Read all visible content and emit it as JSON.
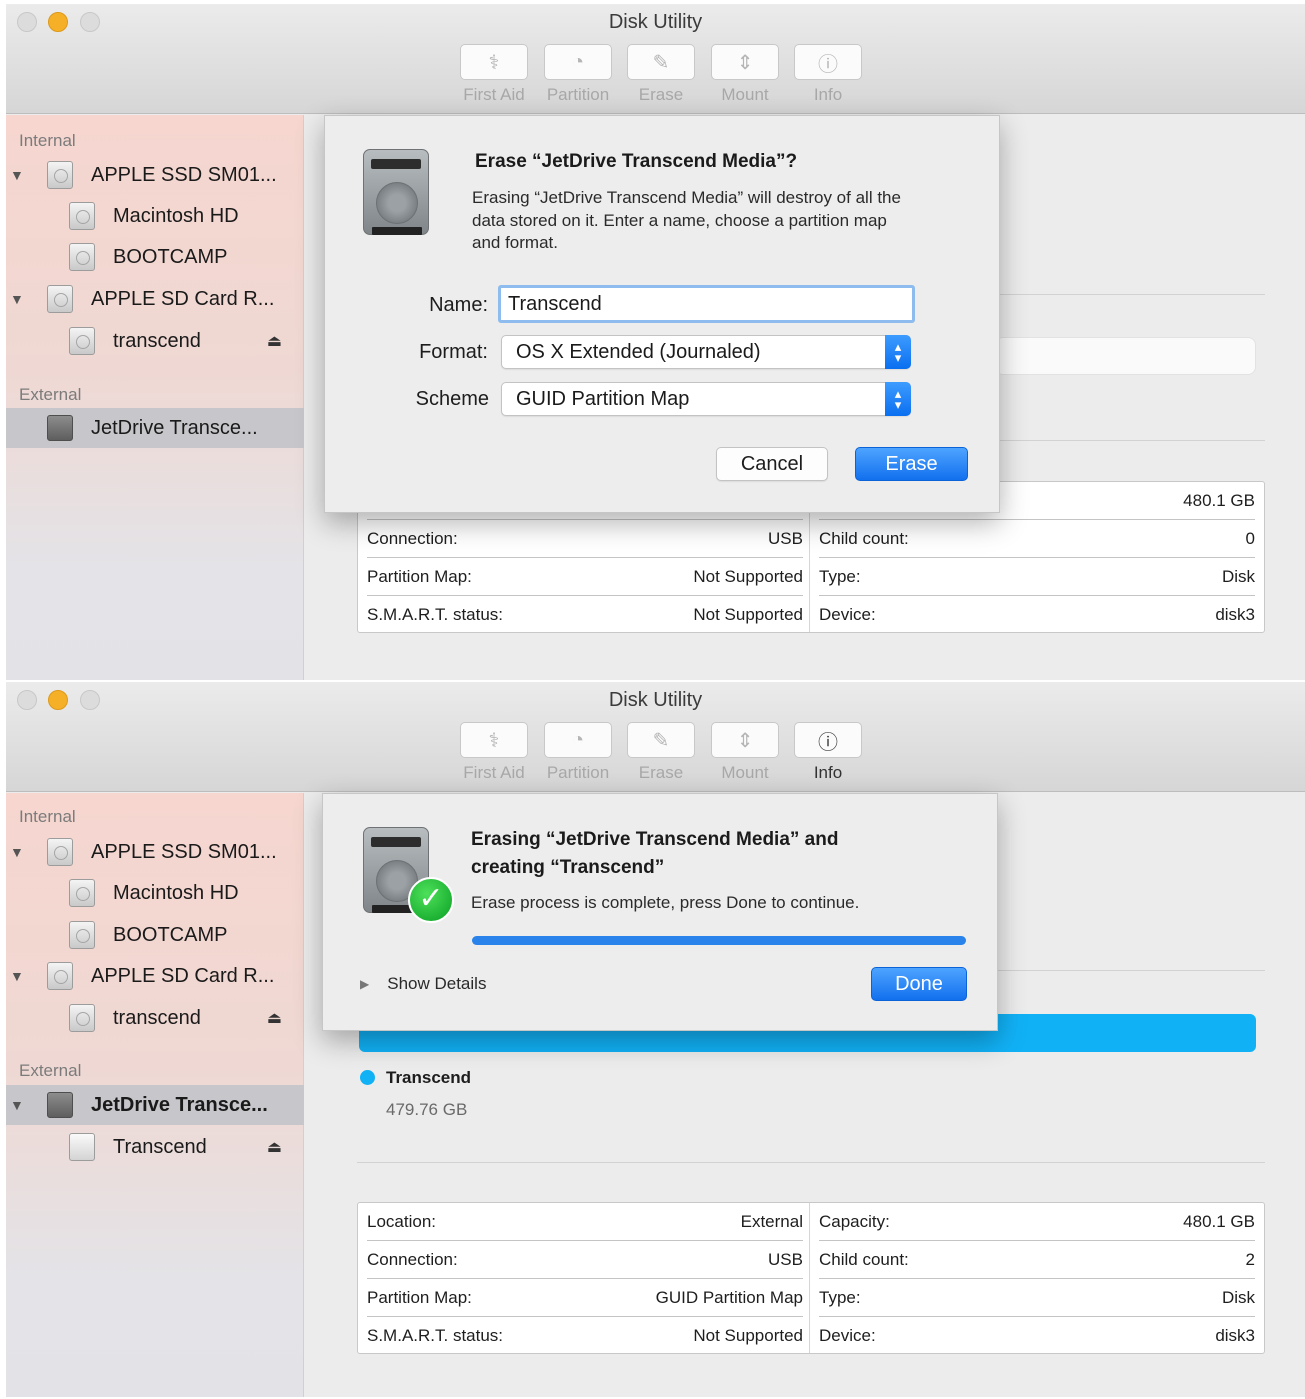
{
  "window1": {
    "title": "Disk Utility",
    "toolbar": [
      "First Aid",
      "Partition",
      "Erase",
      "Mount",
      "Info"
    ],
    "sidebar": {
      "internal_label": "Internal",
      "items": [
        "APPLE SSD SM01...",
        "Macintosh HD",
        "BOOTCAMP",
        "APPLE SD Card R...",
        "transcend"
      ],
      "external_label": "External",
      "external_items": [
        "JetDrive Transce..."
      ]
    },
    "dialog": {
      "title": "Erase “JetDrive Transcend Media”?",
      "message_lines": [
        "Erasing “JetDrive Transcend Media” will destroy of all the",
        "data stored on it. Enter a name, choose a partition map",
        "and format."
      ],
      "name_label": "Name:",
      "name_value": "Transcend",
      "format_label": "Format:",
      "format_value": "OS X Extended (Journaled)",
      "scheme_label": "Scheme",
      "scheme_value": "GUID Partition Map",
      "cancel": "Cancel",
      "erase": "Erase"
    },
    "capacity_value": "480.1 GB",
    "info": {
      "left": [
        {
          "label": "Connection:",
          "value": "USB"
        },
        {
          "label": "Partition Map:",
          "value": "Not Supported"
        },
        {
          "label": "S.M.A.R.T. status:",
          "value": "Not Supported"
        }
      ],
      "right": [
        {
          "label": "Child count:",
          "value": "0"
        },
        {
          "label": "Type:",
          "value": "Disk"
        },
        {
          "label": "Device:",
          "value": "disk3"
        }
      ]
    }
  },
  "window2": {
    "title": "Disk Utility",
    "toolbar": [
      "First Aid",
      "Partition",
      "Erase",
      "Mount",
      "Info"
    ],
    "sidebar": {
      "internal_label": "Internal",
      "items": [
        "APPLE SSD SM01...",
        "Macintosh HD",
        "BOOTCAMP",
        "APPLE SD Card R...",
        "transcend"
      ],
      "external_label": "External",
      "external_items": [
        "JetDrive Transce...",
        "Transcend"
      ]
    },
    "dialog": {
      "title_lines": [
        "Erasing “JetDrive Transcend Media” and",
        "creating “Transcend”"
      ],
      "message": "Erase process is complete, press Done to continue.",
      "progress": 1.0,
      "show_details": "Show Details",
      "done": "Done"
    },
    "partition": {
      "name": "Transcend",
      "size": "479.76 GB",
      "color": "#11b1f6"
    },
    "info": {
      "left": [
        {
          "label": "Location:",
          "value": "External"
        },
        {
          "label": "Connection:",
          "value": "USB"
        },
        {
          "label": "Partition Map:",
          "value": "GUID Partition Map"
        },
        {
          "label": "S.M.A.R.T. status:",
          "value": "Not Supported"
        }
      ],
      "right": [
        {
          "label": "Capacity:",
          "value": "480.1 GB"
        },
        {
          "label": "Child count:",
          "value": "2"
        },
        {
          "label": "Type:",
          "value": "Disk"
        },
        {
          "label": "Device:",
          "value": "disk3"
        }
      ]
    }
  },
  "icons": {
    "first_aid": "stethoscope-icon",
    "partition": "pie-icon",
    "erase": "eraser-icon",
    "mount": "mount-arrows-icon",
    "info": "info-icon",
    "disk": "hard-drive-icon",
    "eject": "eject-icon",
    "done": "checkmark-icon"
  }
}
